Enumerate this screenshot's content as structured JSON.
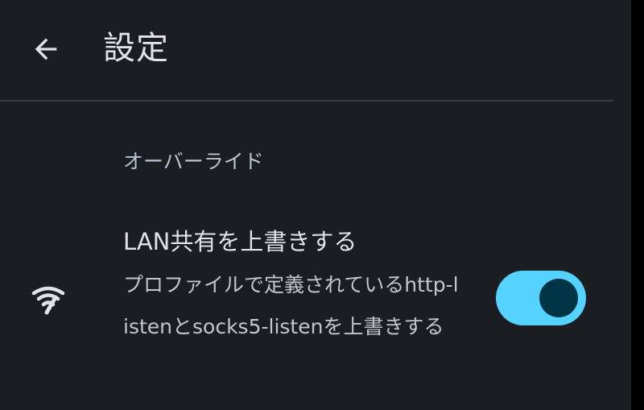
{
  "header": {
    "title": "設定",
    "back_icon": "arrow-back-icon"
  },
  "sections": [
    {
      "header": "オーバーライド",
      "items": [
        {
          "icon": "wifi-share-icon",
          "title": "LAN共有を上書きする",
          "summary": "プロファイルで定義されているhttp-listenとsocks5-listenを上書きする",
          "enabled": true
        }
      ]
    }
  ],
  "colors": {
    "background": "#1a1d21",
    "switch_track": "#56d2ff",
    "switch_thumb": "#003545",
    "divider": "#3b3f45"
  }
}
